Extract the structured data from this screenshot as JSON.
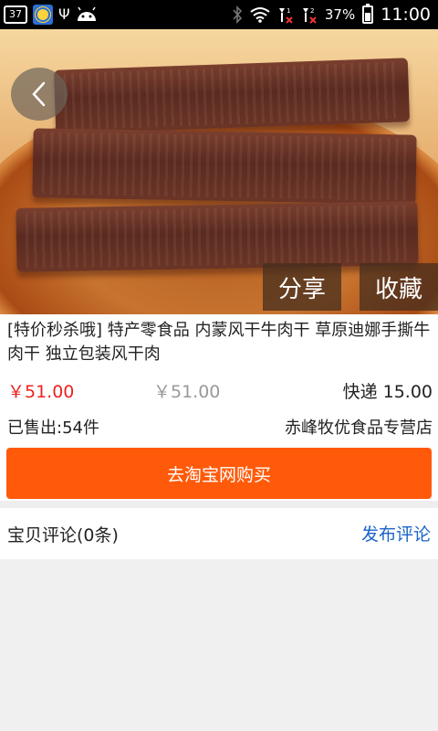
{
  "status_bar": {
    "notification_count": "37",
    "battery_percent": "37%",
    "time": "11:00",
    "icons": [
      "weather-icon",
      "usb-icon",
      "android-icon",
      "bluetooth-icon",
      "wifi-icon",
      "signal1-icon",
      "signal2-icon",
      "battery-icon"
    ]
  },
  "hero": {
    "share_label": "分享",
    "favorite_label": "收藏"
  },
  "product": {
    "title": "[特价秒杀哦] 特产零食品 内蒙风干牛肉干 草原迪娜手撕牛肉干 独立包装风干肉",
    "price": "￥51.00",
    "original_price": "￥51.00",
    "shipping": "快递 15.00",
    "sold": "已售出:54件",
    "shop": "赤峰牧优食品专营店"
  },
  "actions": {
    "buy_label": "去淘宝网购买"
  },
  "reviews": {
    "label": "宝贝评论(0条)",
    "post_label": "发布评论"
  },
  "colors": {
    "accent": "#ff5a0a",
    "price": "#e22222",
    "link": "#1a63c8"
  }
}
